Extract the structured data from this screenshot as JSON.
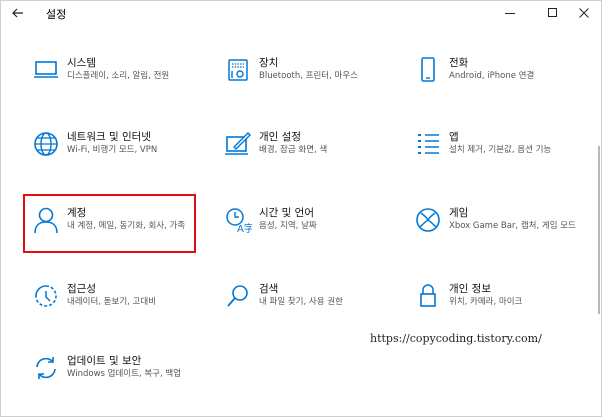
{
  "window": {
    "title": "설정"
  },
  "items": [
    {
      "name": "시스템",
      "desc": "디스플레이, 소리, 알림, 전원",
      "icon": "monitor-icon"
    },
    {
      "name": "장치",
      "desc": "Bluetooth, 프린터, 마우스",
      "icon": "devices-icon"
    },
    {
      "name": "전화",
      "desc": "Android, iPhone 연결",
      "icon": "phone-icon"
    },
    {
      "name": "네트워크 및 인터넷",
      "desc": "Wi-Fi, 비행기 모드, VPN",
      "icon": "globe-icon"
    },
    {
      "name": "개인 설정",
      "desc": "배경, 잠금 화면, 색",
      "icon": "personalization-icon"
    },
    {
      "name": "앱",
      "desc": "설치 제거, 기본값, 옵션 기능",
      "icon": "apps-icon"
    },
    {
      "name": "계정",
      "desc": "내 계정, 메일, 동기화, 회사, 가족",
      "icon": "person-icon"
    },
    {
      "name": "시간 및 언어",
      "desc": "음성, 지역, 날짜",
      "icon": "time-language-icon"
    },
    {
      "name": "게임",
      "desc": "Xbox Game Bar, 캡처, 게임 모드",
      "icon": "xbox-icon"
    },
    {
      "name": "접근성",
      "desc": "내레이터, 돋보기, 고대비",
      "icon": "accessibility-icon"
    },
    {
      "name": "검색",
      "desc": "내 파일 찾기, 사용 권한",
      "icon": "search-icon"
    },
    {
      "name": "개인 정보",
      "desc": "위치, 카메라, 마이크",
      "icon": "lock-icon"
    },
    {
      "name": "업데이트 및 보안",
      "desc": "Windows 업데이트, 복구, 백업",
      "icon": "sync-icon"
    }
  ],
  "watermark": "https://copycoding.tistory.com/",
  "colors": {
    "accent": "#0078d7",
    "highlight_border": "#e01010"
  }
}
